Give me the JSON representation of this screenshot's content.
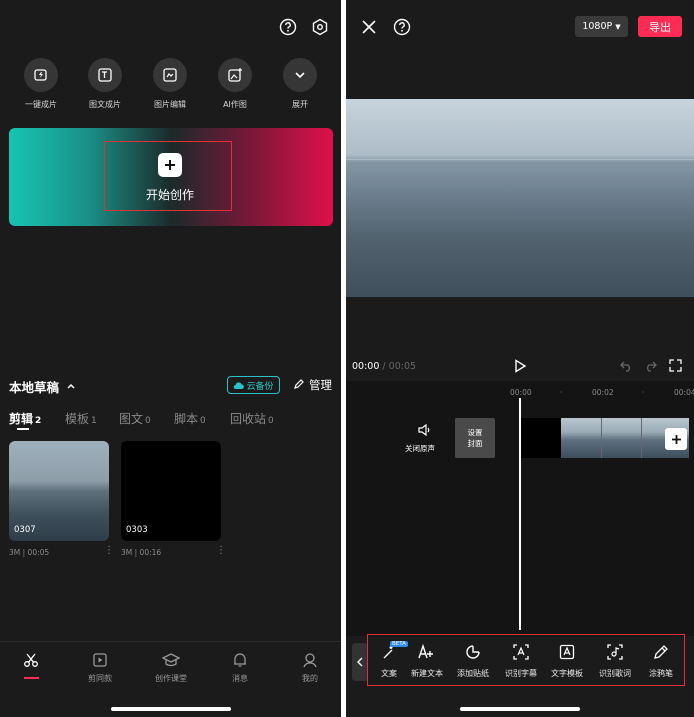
{
  "left": {
    "top_icons": [
      "help-circle-icon",
      "settings-hex-icon"
    ],
    "tools": [
      {
        "label": "一键成片",
        "icon": "auto-video-icon"
      },
      {
        "label": "图文成片",
        "icon": "text-to-video-icon"
      },
      {
        "label": "图片编辑",
        "icon": "image-edit-icon"
      },
      {
        "label": "AI作图",
        "icon": "ai-image-icon"
      },
      {
        "label": "展开",
        "icon": "chevron-down-icon"
      }
    ],
    "hero": {
      "label": "开始创作",
      "icon": "plus-icon"
    },
    "drafts": {
      "title": "本地草稿",
      "cloud_label": "云备份",
      "manage_label": "管理"
    },
    "tabs": [
      {
        "label": "剪辑",
        "count": "2"
      },
      {
        "label": "模板",
        "count": "1"
      },
      {
        "label": "图文",
        "count": "0"
      },
      {
        "label": "脚本",
        "count": "0"
      },
      {
        "label": "回收站",
        "count": "0"
      }
    ],
    "projects": [
      {
        "name": "0307",
        "size": "3M",
        "duration": "00:05"
      },
      {
        "name": "0303",
        "size": "3M",
        "duration": "00:16"
      }
    ],
    "nav": [
      {
        "label": "",
        "icon": "scissors-icon"
      },
      {
        "label": "剪同款",
        "icon": "template-play-icon"
      },
      {
        "label": "创作课堂",
        "icon": "graduation-cap-icon"
      },
      {
        "label": "消息",
        "icon": "bell-icon"
      },
      {
        "label": "我的",
        "icon": "profile-icon"
      }
    ]
  },
  "right": {
    "resolution": "1080P",
    "export_label": "导出",
    "time_current": "00:00",
    "time_separator": "/",
    "time_total": "00:05",
    "ruler": [
      "00:00",
      "00:02",
      "00:04"
    ],
    "mute_label": "关闭原声",
    "cover_line1": "设置",
    "cover_line2": "封面",
    "toolbar": [
      {
        "label": "文案",
        "icon": "magic-wand-icon",
        "badge": "BETA"
      },
      {
        "label": "新建文本",
        "icon": "text-add-icon"
      },
      {
        "label": "添加贴纸",
        "icon": "sticker-icon"
      },
      {
        "label": "识别字幕",
        "icon": "caption-recognize-icon"
      },
      {
        "label": "文字模板",
        "icon": "text-template-icon"
      },
      {
        "label": "识别歌词",
        "icon": "lyrics-recognize-icon"
      },
      {
        "label": "涂鸦笔",
        "icon": "pen-icon"
      }
    ],
    "colors": {
      "export": "#fe2c55",
      "highlight": "#e0303a"
    }
  }
}
